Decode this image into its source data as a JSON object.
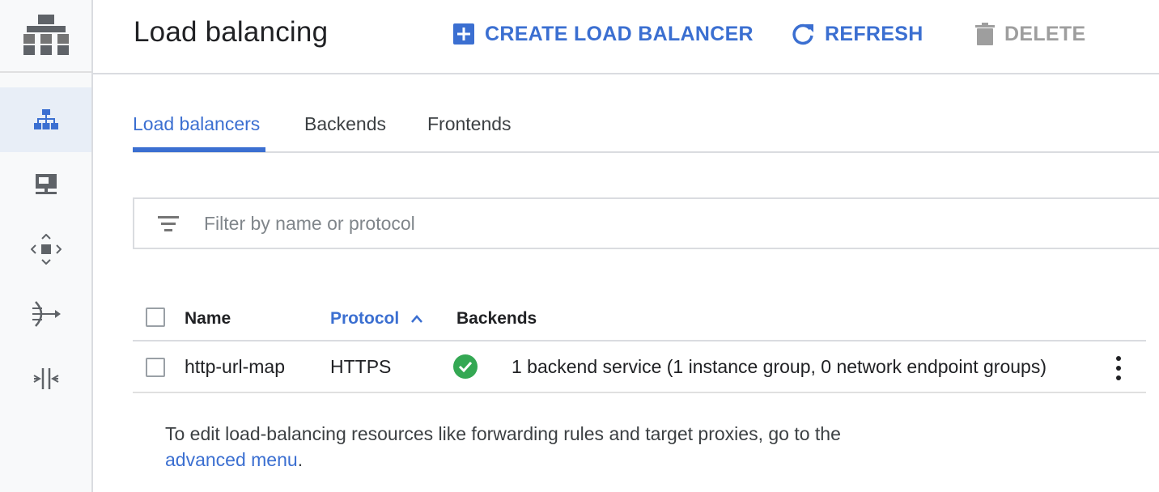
{
  "header": {
    "title": "Load balancing",
    "create_label": "CREATE LOAD BALANCER",
    "refresh_label": "REFRESH",
    "delete_label": "DELETE"
  },
  "rail": {
    "items": [
      {
        "icon": "load-balancer-icon",
        "active": true
      },
      {
        "icon": "instance-icon",
        "active": false
      },
      {
        "icon": "network-move-icon",
        "active": false
      },
      {
        "icon": "forwarding-icon",
        "active": false
      },
      {
        "icon": "pinch-icon",
        "active": false
      }
    ]
  },
  "tabs": [
    {
      "label": "Load balancers",
      "active": true
    },
    {
      "label": "Backends",
      "active": false
    },
    {
      "label": "Frontends",
      "active": false
    }
  ],
  "filter": {
    "placeholder": "Filter by name or protocol",
    "value": ""
  },
  "table": {
    "columns": {
      "name": "Name",
      "protocol": "Protocol",
      "backends": "Backends"
    },
    "sort": {
      "column": "protocol",
      "direction": "ascending"
    },
    "rows": [
      {
        "name": "http-url-map",
        "protocol": "HTTPS",
        "status": "ok",
        "backends": "1 backend service (1 instance group, 0 network endpoint groups)"
      }
    ]
  },
  "note": {
    "text": "To edit load-balancing resources like forwarding rules and target proxies, go to the",
    "link": "advanced menu",
    "suffix": "."
  },
  "colors": {
    "accent": "#3b6fd1",
    "ok": "#34a853",
    "disabled": "#9e9e9e"
  }
}
